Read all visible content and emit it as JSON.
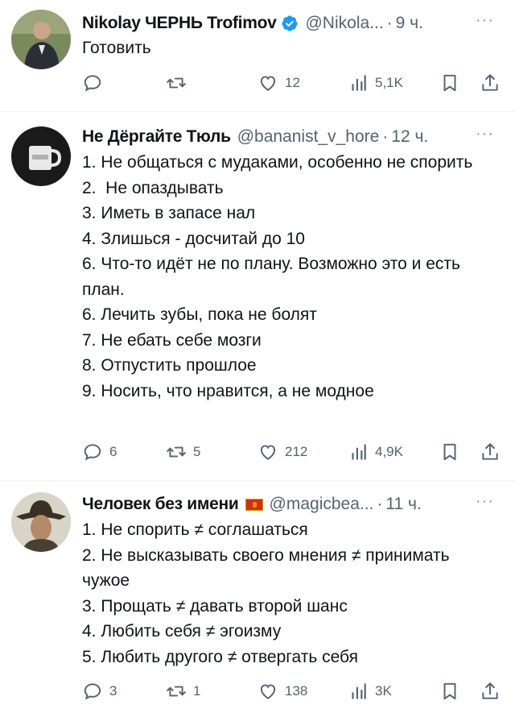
{
  "tweets": [
    {
      "name": "Nikolay ЧЕРНЬ Trofimov",
      "handle": "@Nikola...",
      "time": "9 ч.",
      "body": "Готовить",
      "replies": "",
      "retweets": "",
      "likes": "12",
      "views": "5,1K",
      "badge": "verified-icon"
    },
    {
      "name": "Не Дёргайте Тюль",
      "handle": "@bananist_v_hore",
      "time": "12 ч.",
      "body": "1. Не общаться с мудаками, особенно не спорить\n2.  Не опаздывать\n3. Иметь в запасе нал\n4. Злишься - досчитай до 10\n6. Что-то идёт не по плану. Возможно это и есть план.\n6. Лечить зубы, пока не болят\n7. Не ебать себе мозги\n8. Отпустить прошлое\n9. Носить, что нравится, а не модное",
      "replies": "6",
      "retweets": "5",
      "likes": "212",
      "views": "4,9K",
      "badge": ""
    },
    {
      "name": "Человек без имени",
      "handle": "@magicbea...",
      "time": "11 ч.",
      "body": "1. Не спорить ≠ соглашаться\n2. Не высказывать своего мнения ≠ принимать чужое\n3. Прощать ≠ давать второй шанс\n4. Любить себя ≠ эгоизму\n5. Любить другого ≠ отвергать себя",
      "replies": "3",
      "retweets": "1",
      "likes": "138",
      "views": "3K",
      "badge": "montenegro-flag-icon"
    }
  ],
  "separator": "·",
  "more": "···",
  "colors": {
    "text": "#0f1419",
    "secondary": "#536471",
    "verified": "#1d9bf0",
    "divider": "#eff3f4"
  }
}
